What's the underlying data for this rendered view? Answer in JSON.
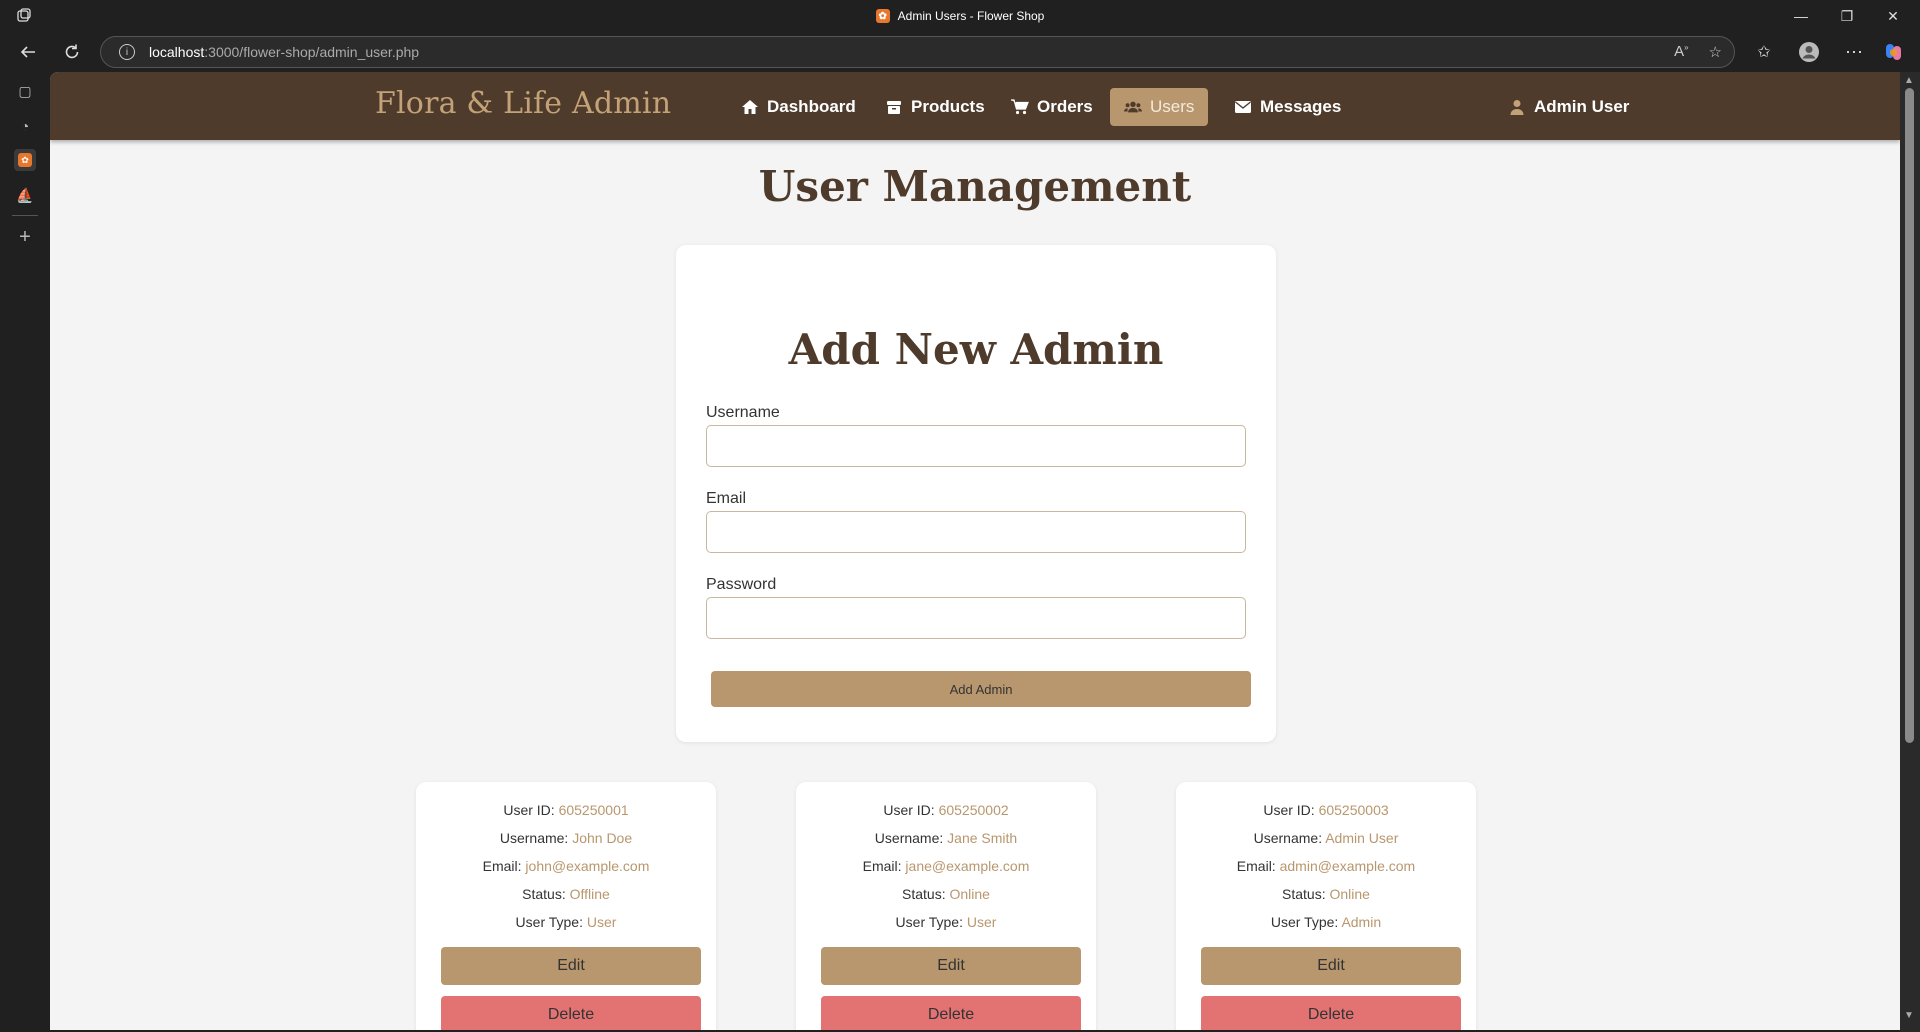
{
  "browser": {
    "window_title": "Admin Users - Flower Shop",
    "url_host": "localhost",
    "url_path": ":3000/flower-shop/admin_user.php"
  },
  "nav": {
    "brand": "Flora & Life Admin",
    "items": [
      {
        "label": "Dashboard",
        "icon": "home-icon"
      },
      {
        "label": "Products",
        "icon": "box-icon"
      },
      {
        "label": "Orders",
        "icon": "cart-icon"
      },
      {
        "label": "Users",
        "icon": "users-icon",
        "active": true
      },
      {
        "label": "Messages",
        "icon": "envelope-icon"
      }
    ],
    "user_label": "Admin User"
  },
  "page": {
    "title": "User Management"
  },
  "form": {
    "title": "Add New Admin",
    "username_label": "Username",
    "username_value": "",
    "email_label": "Email",
    "email_value": "",
    "password_label": "Password",
    "password_value": "",
    "submit_label": "Add Admin"
  },
  "labels": {
    "user_id": "User ID:",
    "username": "Username:",
    "email": "Email:",
    "status": "Status:",
    "user_type": "User Type:",
    "edit": "Edit",
    "delete": "Delete"
  },
  "users": [
    {
      "id": "605250001",
      "username": "John Doe",
      "email": "john@example.com",
      "status": "Offline",
      "type": "User"
    },
    {
      "id": "605250002",
      "username": "Jane Smith",
      "email": "jane@example.com",
      "status": "Online",
      "type": "User"
    },
    {
      "id": "605250003",
      "username": "Admin User",
      "email": "admin@example.com",
      "status": "Online",
      "type": "Admin"
    }
  ],
  "colors": {
    "navbar": "#4e3b2c",
    "accent": "#b8976e",
    "delete": "#e37373",
    "background": "#f4f4f4"
  }
}
